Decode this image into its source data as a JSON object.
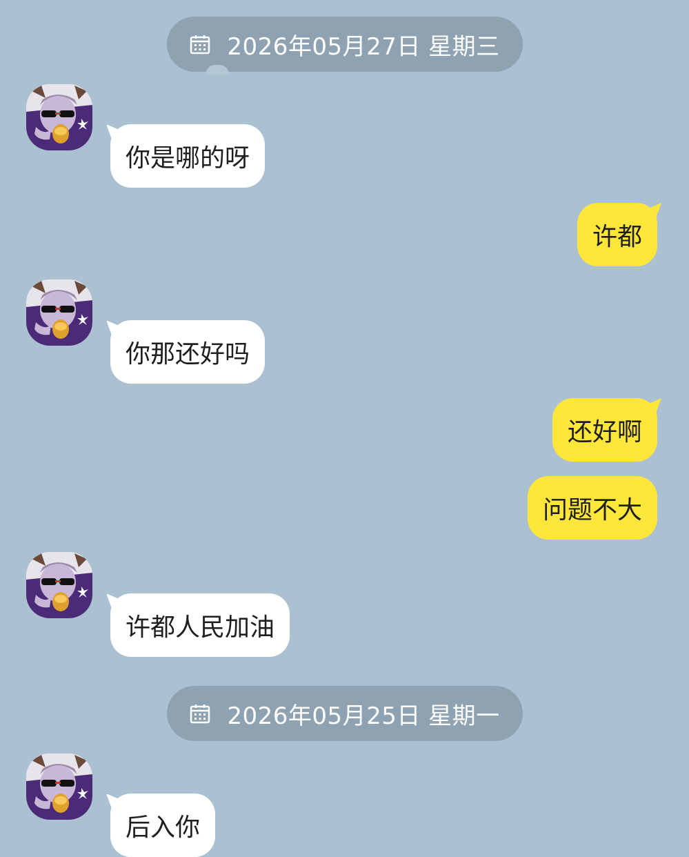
{
  "dates": [
    {
      "label": "2026年05月27日 星期三",
      "icon": "calendar-icon"
    },
    {
      "label": "2026年05月25日 星期一",
      "icon": "calendar-icon"
    }
  ],
  "messages": [
    {
      "side": "in",
      "text": "你是哪的呀"
    },
    {
      "side": "out",
      "text": "许都"
    },
    {
      "side": "in",
      "text": "你那还好吗"
    },
    {
      "side": "out",
      "text": "还好啊"
    },
    {
      "side": "out",
      "text": "问题不大"
    },
    {
      "side": "in",
      "text": "许都人民加油"
    },
    {
      "side": "in",
      "text": "后入你"
    }
  ],
  "colors": {
    "background": "#abc1d1",
    "date_pill": "#8fa2b2",
    "incoming_bubble": "#ffffff",
    "outgoing_bubble": "#fee63a"
  }
}
